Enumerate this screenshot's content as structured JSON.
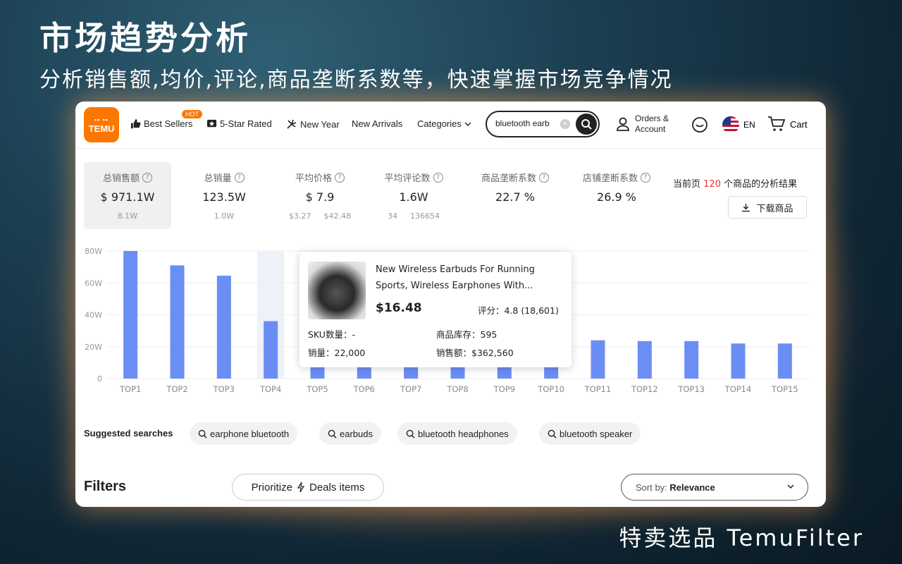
{
  "banner": {
    "headline": "市场趋势分析",
    "subline": "分析销售额,均价,评论,商品垄断系数等，快速掌握市场竞争情况",
    "footer": "特卖选品 TemuFilter"
  },
  "nav": {
    "logo_top": "🟧🟧🟧",
    "logo_text": "TEMU",
    "items": [
      {
        "label": "Best Sellers",
        "icon": "thumbs-up-icon"
      },
      {
        "label": "5-Star Rated",
        "icon": "star-badge-icon"
      },
      {
        "label": "New Year",
        "icon": "firework-icon"
      },
      {
        "label": "New Arrivals",
        "icon": ""
      },
      {
        "label": "Categories",
        "icon": "chevron-down-icon"
      }
    ],
    "hot_badge": "HOT",
    "search_value": "bluetooth earb",
    "orders_line1": "Orders &",
    "orders_line2": "Account",
    "lang": "EN",
    "cart": "Cart"
  },
  "stats": [
    {
      "label": "总销售额",
      "value": "$ 971.1W",
      "sub": [
        "8.1W"
      ]
    },
    {
      "label": "总销量",
      "value": "123.5W",
      "sub": [
        "1.0W"
      ]
    },
    {
      "label": "平均价格",
      "value": "$ 7.9",
      "sub": [
        "$3.27",
        "$42.48"
      ]
    },
    {
      "label": "平均评论数",
      "value": "1.6W",
      "sub": [
        "34",
        "136654"
      ]
    },
    {
      "label": "商品垄断系数",
      "value": "22.7 %",
      "sub": []
    },
    {
      "label": "店铺垄断系数",
      "value": "26.9 %",
      "sub": []
    }
  ],
  "result": {
    "prefix": "当前页",
    "count": "120",
    "suffix": "个商品的分析结果",
    "download": "下载商品"
  },
  "chart_data": {
    "type": "bar",
    "categories": [
      "TOP1",
      "TOP2",
      "TOP3",
      "TOP4",
      "TOP5",
      "TOP6",
      "TOP7",
      "TOP8",
      "TOP9",
      "TOP10",
      "TOP11",
      "TOP12",
      "TOP13",
      "TOP14",
      "TOP15"
    ],
    "values": [
      80,
      71,
      64.5,
      36,
      30,
      29,
      29,
      29,
      28.5,
      27.5,
      24,
      23.5,
      23.5,
      22,
      22
    ],
    "yticks": [
      "0",
      "20W",
      "40W",
      "60W",
      "80W"
    ],
    "ylim": [
      0,
      80
    ],
    "highlighted_index": 3,
    "color": "#6b8ef5"
  },
  "tooltip": {
    "title": "New Wireless Earbuds For Running Sports, Wireless Earphones With...",
    "price": "$16.48",
    "rating": "评分：4.8 (18,601)",
    "sku": "SKU数量：-",
    "stock": "商品库存：595",
    "sales": "销量：22,000",
    "revenue": "销售额：$362,560"
  },
  "suggested": {
    "label": "Suggested searches",
    "chips": [
      "earphone bluetooth",
      "earbuds",
      "bluetooth headphones",
      "bluetooth speaker"
    ]
  },
  "filters": {
    "label": "Filters",
    "prioritize_prefix": "Prioritize",
    "prioritize_suffix": "Deals items",
    "sort_label": "Sort by:",
    "sort_value": "Relevance"
  }
}
